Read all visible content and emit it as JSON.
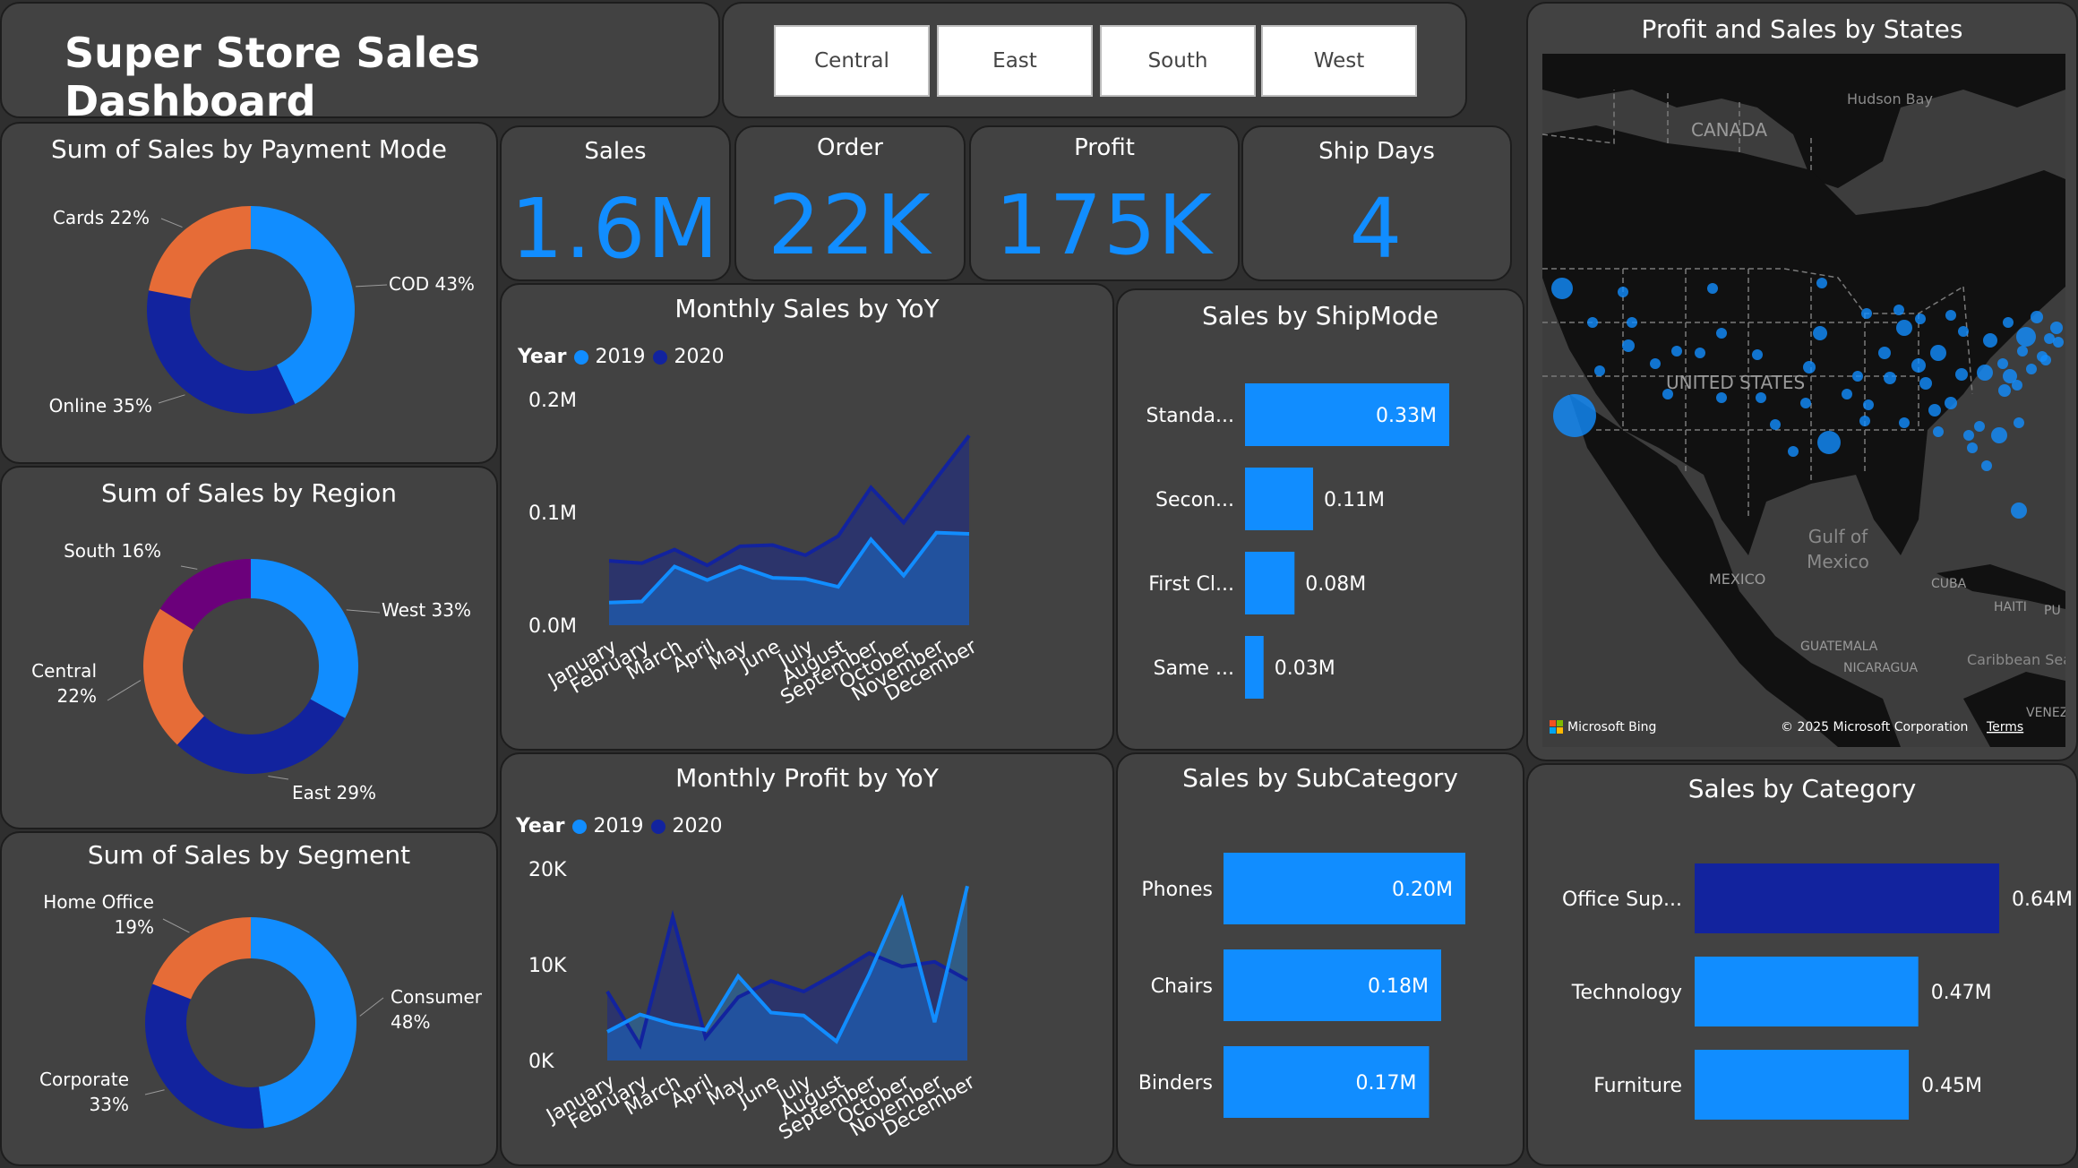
{
  "header": {
    "title": "Super Store Sales Dashboard"
  },
  "slicer": {
    "items": [
      "Central",
      "East",
      "South",
      "West"
    ]
  },
  "colors": {
    "blue": "#118dff",
    "navy": "#12239e",
    "orange": "#e66c37",
    "purple": "#6b007b"
  },
  "kpis": [
    {
      "label": "Sales",
      "value": "1.6M"
    },
    {
      "label": "Order",
      "value": "22K"
    },
    {
      "label": "Profit",
      "value": "175K"
    },
    {
      "label": "Ship Days",
      "value": "4"
    }
  ],
  "payment": {
    "title": "Sum of Sales by Payment Mode",
    "slices": [
      {
        "label": "COD 43%",
        "value": 43,
        "color": "#118dff"
      },
      {
        "label": "Online 35%",
        "value": 35,
        "color": "#12239e"
      },
      {
        "label": "Cards 22%",
        "value": 22,
        "color": "#e66c37"
      }
    ]
  },
  "region": {
    "title": "Sum of Sales by Region",
    "slices": [
      {
        "label": "West 33%",
        "value": 33,
        "color": "#118dff"
      },
      {
        "label": "East 29%",
        "value": 29,
        "color": "#12239e"
      },
      {
        "label": "Central\n22%",
        "value": 22,
        "color": "#e66c37"
      },
      {
        "label": "South 16%",
        "value": 16,
        "color": "#6b007b"
      }
    ]
  },
  "segment": {
    "title": "Sum of Sales by Segment",
    "slices": [
      {
        "label": "Consumer\n48%",
        "value": 48,
        "color": "#118dff"
      },
      {
        "label": "Corporate\n33%",
        "value": 33,
        "color": "#12239e"
      },
      {
        "label": "Home Office\n19%",
        "value": 19,
        "color": "#e66c37"
      }
    ]
  },
  "legend": {
    "year_label": "Year",
    "y2019": "2019",
    "y2020": "2020"
  },
  "monthly_sales": {
    "title": "Monthly Sales by YoY",
    "months": [
      "January",
      "February",
      "March",
      "April",
      "May",
      "June",
      "July",
      "August",
      "September",
      "October",
      "November",
      "December"
    ],
    "yticks": [
      "0.2M",
      "0.1M",
      "0.0M"
    ],
    "ymax": 0.2,
    "s2019": [
      0.02,
      0.021,
      0.052,
      0.04,
      0.052,
      0.042,
      0.041,
      0.034,
      0.076,
      0.044,
      0.082,
      0.081
    ],
    "s2020": [
      0.057,
      0.055,
      0.067,
      0.053,
      0.07,
      0.071,
      0.062,
      0.079,
      0.122,
      0.091,
      0.13,
      0.168
    ]
  },
  "monthly_profit": {
    "title": "Monthly Profit by YoY",
    "months": [
      "January",
      "February",
      "March",
      "April",
      "May",
      "June",
      "July",
      "August",
      "September",
      "October",
      "November",
      "December"
    ],
    "yticks": [
      "20K",
      "10K",
      "0K"
    ],
    "ymax": 20,
    "s2019": [
      3.0,
      4.8,
      3.8,
      3.2,
      8.8,
      5.0,
      4.7,
      2.0,
      9.0,
      16.8,
      4.0,
      18.2
    ],
    "s2020": [
      7.2,
      1.6,
      15.0,
      2.4,
      6.6,
      8.3,
      7.2,
      9.1,
      11.2,
      9.8,
      10.3,
      8.4
    ]
  },
  "shipmode": {
    "title": "Sales by ShipMode",
    "max": 0.33,
    "bars": [
      {
        "label": "Standa...",
        "value": 0.33,
        "text": "0.33M"
      },
      {
        "label": "Secon...",
        "value": 0.11,
        "text": "0.11M"
      },
      {
        "label": "First Cl...",
        "value": 0.08,
        "text": "0.08M"
      },
      {
        "label": "Same ...",
        "value": 0.03,
        "text": "0.03M"
      }
    ]
  },
  "subcategory": {
    "title": "Sales by SubCategory",
    "max": 0.2,
    "bars": [
      {
        "label": "Phones",
        "value": 0.2,
        "text": "0.20M"
      },
      {
        "label": "Chairs",
        "value": 0.18,
        "text": "0.18M"
      },
      {
        "label": "Binders",
        "value": 0.17,
        "text": "0.17M"
      }
    ]
  },
  "category": {
    "title": "Sales by Category",
    "max": 0.64,
    "bars": [
      {
        "label": "Office Sup...",
        "value": 0.64,
        "text": "0.64M",
        "color": "#12239e"
      },
      {
        "label": "Technology",
        "value": 0.47,
        "text": "0.47M",
        "color": "#118dff"
      },
      {
        "label": "Furniture",
        "value": 0.45,
        "text": "0.45M",
        "color": "#118dff"
      }
    ]
  },
  "map": {
    "title": "Profit and Sales by States",
    "labels": {
      "canada": "CANADA",
      "hudson": "Hudson Bay",
      "us": "UNITED STATES",
      "mexico": "MEXICO",
      "gulf": "Gulf of\nMexico",
      "cuba": "CUBA",
      "haiti": "HAITI",
      "guatemala": "GUATEMALA",
      "nicaragua": "NICARAGUA",
      "caribbean": "Caribbean Sea",
      "venez": "VENEZ",
      "pr": "PU\n(US"
    },
    "bing": "Microsoft Bing",
    "copyright": "© 2025 Microsoft Corporation",
    "terms": "Terms"
  }
}
